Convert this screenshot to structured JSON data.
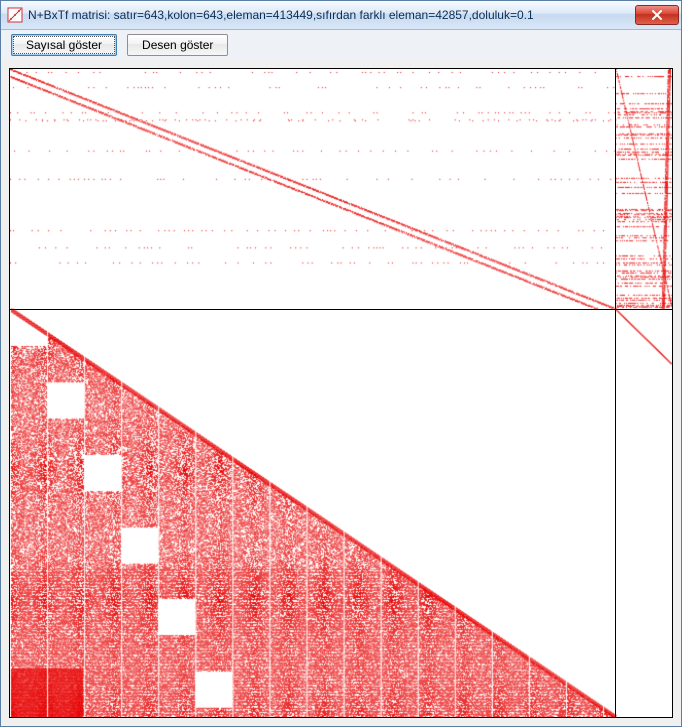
{
  "window": {
    "title": "N+BxTf matrisi: satır=643,kolon=643,eleman=413449,sıfırdan farklı eleman=42857,doluluk=0.1"
  },
  "toolbar": {
    "numeric_button_label": "Sayısal göster",
    "pattern_button_label": "Desen göster"
  },
  "matrix": {
    "rows": 643,
    "cols": 643,
    "total_elements": 413449,
    "nonzero_elements": 42857,
    "density": 0.1,
    "dot_color": "#e60000",
    "partition_row_fraction": 0.37,
    "partition_col_fraction": 0.915
  }
}
